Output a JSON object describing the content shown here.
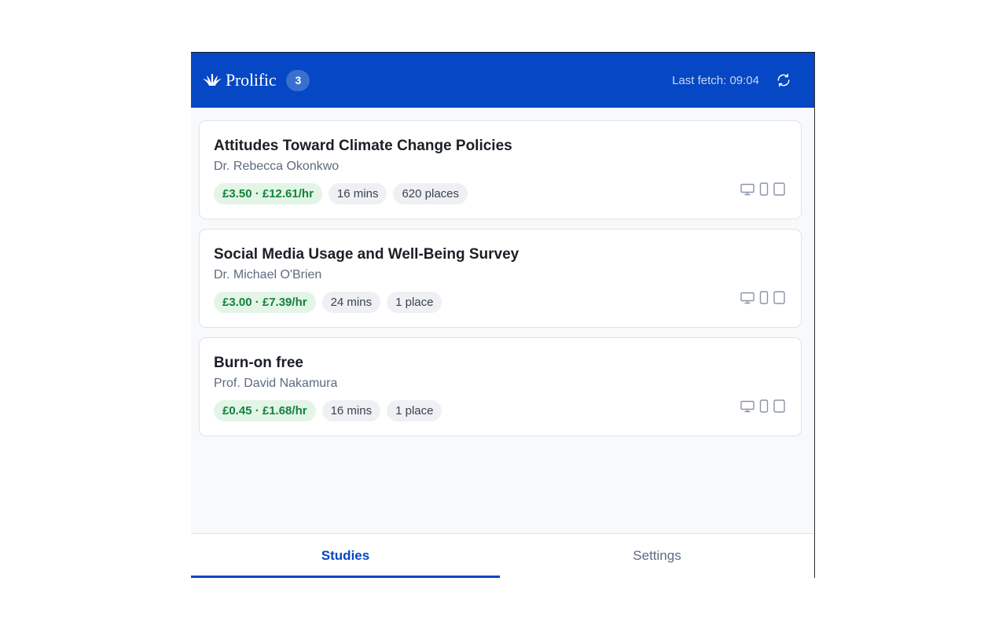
{
  "header": {
    "logo_text": "Prolific",
    "study_count": "3",
    "last_fetch": "Last fetch: 09:04",
    "refresh_icon": "refresh-icon"
  },
  "studies": [
    {
      "title": "Attitudes Toward Climate Change Policies",
      "researcher": "Dr. Rebecca Okonkwo",
      "reward": "£3.50 · £12.61/hr",
      "duration": "16 mins",
      "places": "620 places"
    },
    {
      "title": "Social Media Usage and Well-Being Survey",
      "researcher": "Dr. Michael O'Brien",
      "reward": "£3.00 · £7.39/hr",
      "duration": "24 mins",
      "places": "1 place"
    },
    {
      "title": "Burn-on free",
      "researcher": "Prof. David Nakamura",
      "reward": "£0.45 · £1.68/hr",
      "duration": "16 mins",
      "places": "1 place"
    }
  ],
  "device_icons": [
    "desktop-icon",
    "mobile-icon",
    "tablet-icon"
  ],
  "tabs": [
    {
      "label": "Studies",
      "active": true
    },
    {
      "label": "Settings",
      "active": false
    }
  ],
  "colors": {
    "brand": "#0547c4",
    "reward_bg": "#e3f5e7",
    "reward_text": "#14823a"
  }
}
